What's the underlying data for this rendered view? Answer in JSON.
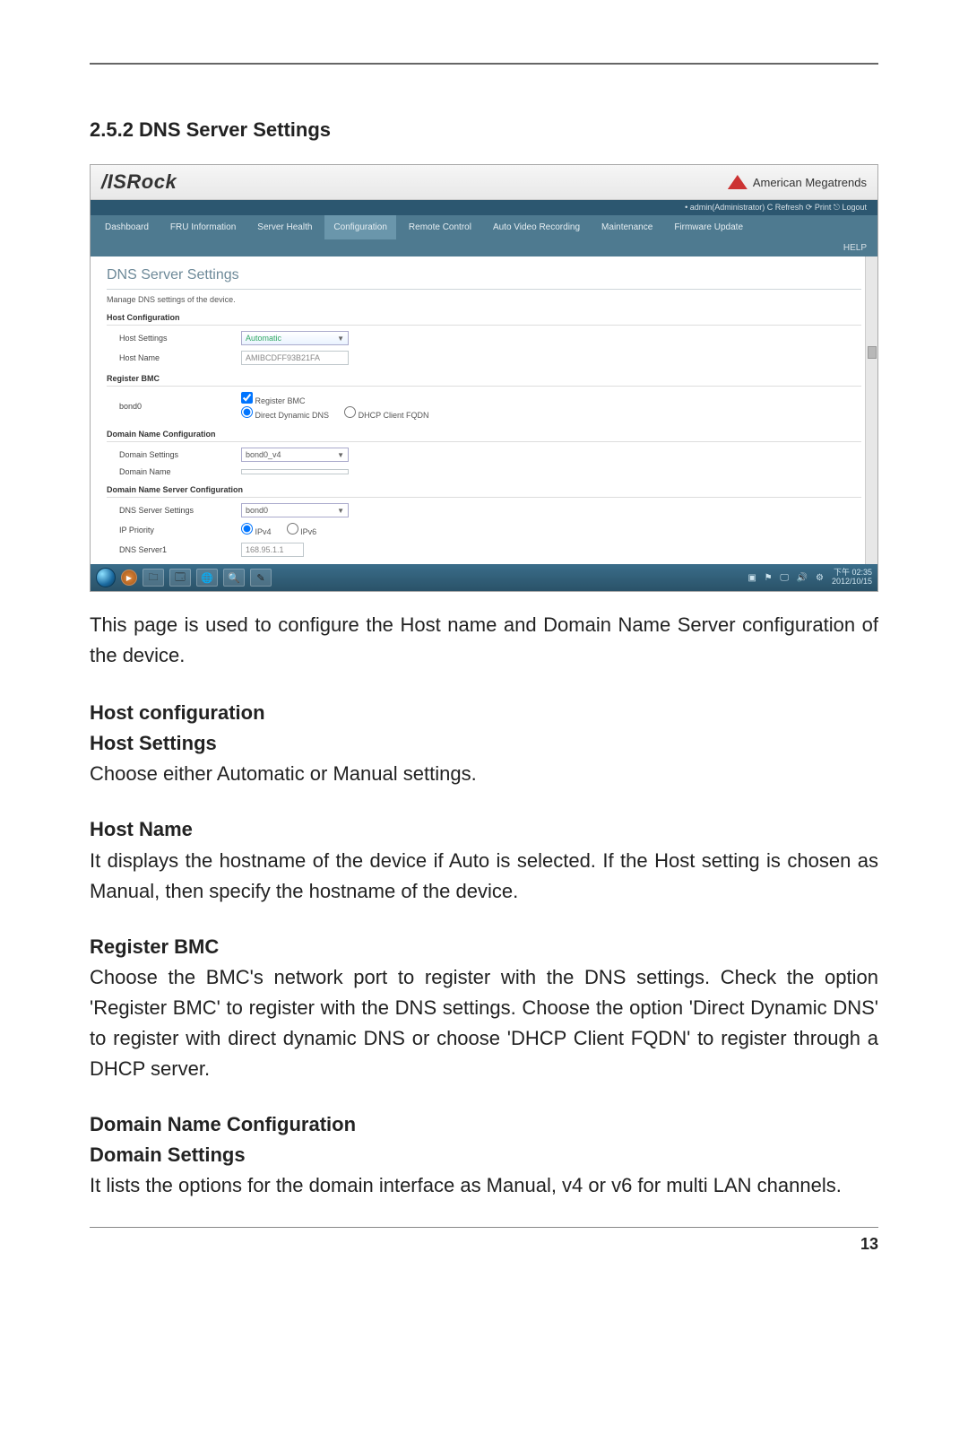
{
  "section_title": "2.5.2  DNS Server Settings",
  "screenshot": {
    "logo": "/ISRock",
    "ami": "American Megatrends",
    "subbar": "• admin(Administrator)   C Refresh   ⟳ Print   ⎋ Logout",
    "nav": [
      "Dashboard",
      "FRU Information",
      "Server Health",
      "Configuration",
      "Remote Control",
      "Auto Video Recording",
      "Maintenance",
      "Firmware Update"
    ],
    "nav_active_index": 3,
    "help": "HELP",
    "title": "DNS Server Settings",
    "desc": "Manage DNS settings of the device.",
    "host_config": {
      "section": "Host Configuration",
      "host_settings_label": "Host Settings",
      "host_settings_value": "Automatic",
      "host_name_label": "Host Name",
      "host_name_value": "AMIBCDFF93B21FA"
    },
    "register_bmc": {
      "section": "Register BMC",
      "bond_label": "bond0",
      "checkbox": "Register BMC",
      "radio1": "Direct Dynamic DNS",
      "radio2": "DHCP Client FQDN"
    },
    "domain_name_config": {
      "section": "Domain Name Configuration",
      "domain_settings_label": "Domain Settings",
      "domain_settings_value": "bond0_v4",
      "domain_name_label": "Domain Name",
      "domain_name_value": ""
    },
    "dns_server_config": {
      "section": "Domain Name Server Configuration",
      "dns_settings_label": "DNS Server Settings",
      "dns_settings_value": "bond0",
      "ip_priority_label": "IP Priority",
      "radio_ipv4": "IPv4",
      "radio_ipv6": "IPv6",
      "dns_server1_label": "DNS Server1",
      "dns_server1_value": "168.95.1.1"
    },
    "taskbar": {
      "time": "下午 02:35",
      "date": "2012/10/15"
    }
  },
  "body": {
    "intro": "This page is used to configure the Host name and Domain Name Server configuration of the device.",
    "host_config_title": "Host configuration",
    "host_settings_title": "Host Settings",
    "host_settings_text": "Choose either Automatic or Manual settings.",
    "host_name_title": "Host Name",
    "host_name_text": "It displays the hostname of the device if Auto is selected. If the Host setting is chosen as Manual, then specify the hostname of the device.",
    "register_bmc_title": "Register BMC",
    "register_bmc_text": "Choose the BMC's network port to register with the DNS settings. Check the option 'Register BMC' to register with the DNS settings. Choose the option 'Direct Dynamic DNS' to register with direct dynamic DNS or choose 'DHCP Client FQDN' to register through a DHCP server.",
    "domain_config_title": "Domain Name Configuration",
    "domain_settings_title": "Domain Settings",
    "domain_settings_text": "It lists the options for the domain interface as Manual, v4 or v6 for multi LAN channels."
  },
  "page_number": "13"
}
